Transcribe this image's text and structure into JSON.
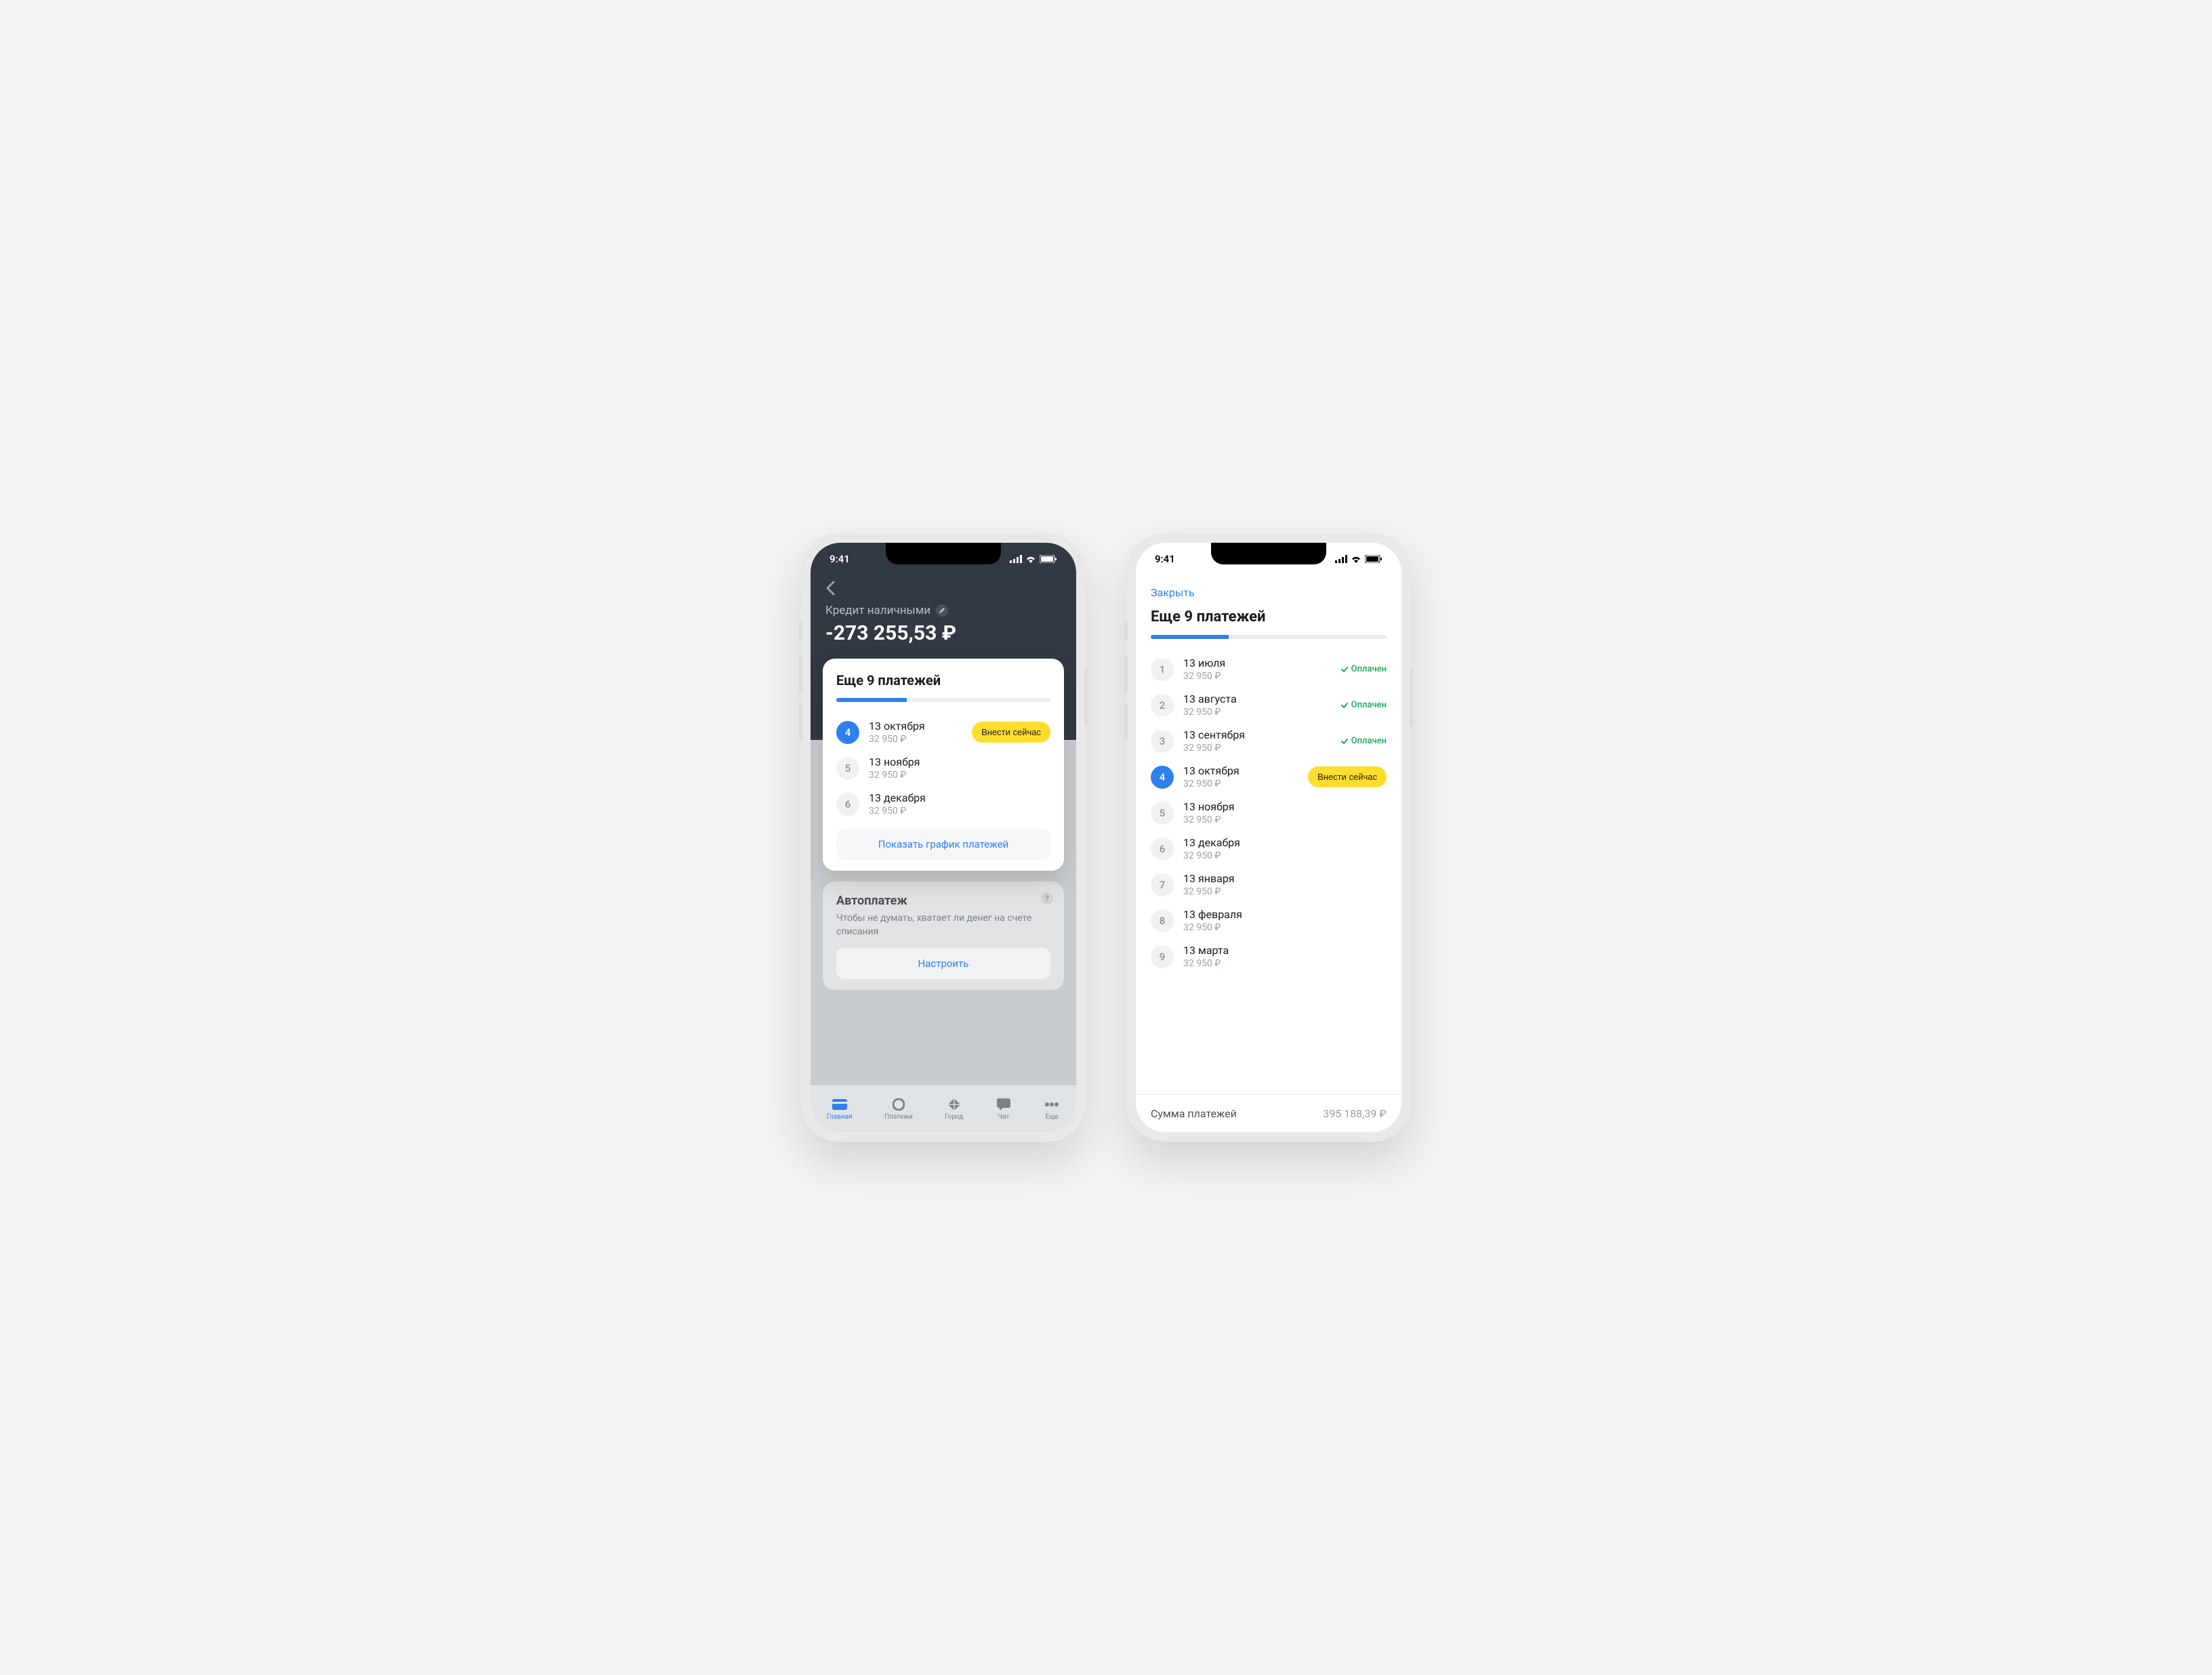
{
  "statusbar": {
    "time": "9:41"
  },
  "screen1": {
    "loan_title": "Кредит наличными",
    "loan_balance": "-273 255,53 ₽",
    "card_title": "Еще 9 платежей",
    "progress_pct": 33,
    "payments": [
      {
        "num": "4",
        "date": "13 октября",
        "amount": "32 950 ₽",
        "current": true,
        "action": "Внести сейчас"
      },
      {
        "num": "5",
        "date": "13 ноября",
        "amount": "32 950 ₽"
      },
      {
        "num": "6",
        "date": "13 декабря",
        "amount": "32 950 ₽"
      }
    ],
    "show_schedule_label": "Показать график платежей",
    "autopay": {
      "title": "Автоплатеж",
      "desc": "Чтобы не думать, хватает ли денег на счете списания",
      "button": "Настроить"
    },
    "tabs": [
      {
        "label": "Главная",
        "icon": "card",
        "active": true
      },
      {
        "label": "Платежи",
        "icon": "circle",
        "active": false
      },
      {
        "label": "Город",
        "icon": "diamond",
        "active": false
      },
      {
        "label": "Чат",
        "icon": "chat",
        "active": false
      },
      {
        "label": "Еще",
        "icon": "dots",
        "active": false
      }
    ]
  },
  "screen2": {
    "close_label": "Закрыть",
    "title": "Еще 9 платежей",
    "progress_pct": 33,
    "paid_label": "Оплачен",
    "pay_now_label": "Внести сейчас",
    "payments": [
      {
        "num": "1",
        "date": "13 июля",
        "amount": "32 950 ₽",
        "paid": true
      },
      {
        "num": "2",
        "date": "13 августа",
        "amount": "32 950 ₽",
        "paid": true
      },
      {
        "num": "3",
        "date": "13 сентября",
        "amount": "32 950 ₽",
        "paid": true
      },
      {
        "num": "4",
        "date": "13 октября",
        "amount": "32 950 ₽",
        "current": true
      },
      {
        "num": "5",
        "date": "13 ноября",
        "amount": "32 950 ₽"
      },
      {
        "num": "6",
        "date": "13 декабря",
        "amount": "32 950 ₽"
      },
      {
        "num": "7",
        "date": "13 января",
        "amount": "32 950 ₽"
      },
      {
        "num": "8",
        "date": "13 февраля",
        "amount": "32 950 ₽"
      },
      {
        "num": "9",
        "date": "13 марта",
        "amount": "32 950 ₽"
      }
    ],
    "totals_label": "Сумма платежей",
    "totals_value": "395 188,39 ₽"
  }
}
